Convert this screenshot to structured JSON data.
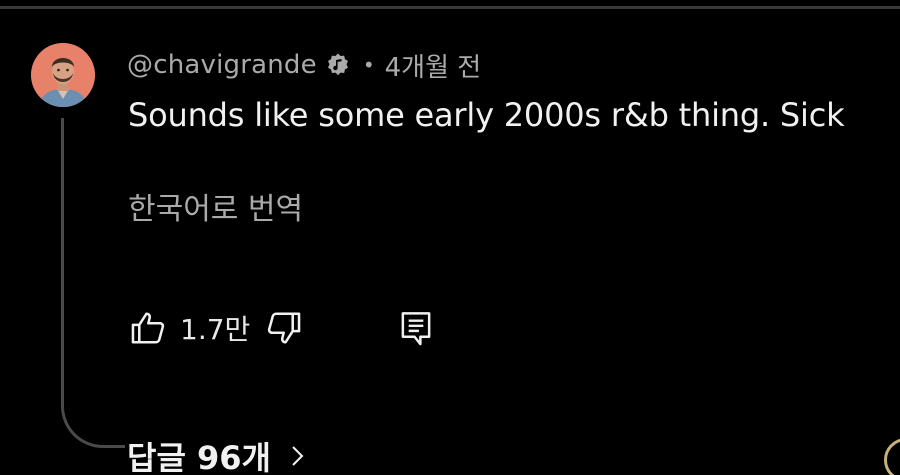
{
  "comment": {
    "handle": "@chavigrande",
    "badge_icon": "music-note-verified-badge-icon",
    "separator": "•",
    "time": "4개월 전",
    "text": "Sounds like some early 2000s r&b thing. Sick",
    "translate_label": "한국어로 번역",
    "like_count": "1.7만",
    "replies_label": "답글 96개"
  },
  "icons": {
    "like": "thumbs-up-icon",
    "dislike": "thumbs-down-icon",
    "reply": "comment-reply-icon",
    "replies_chevron": "chevron-right-icon"
  },
  "colors": {
    "background": "#000000",
    "primary_text": "#f1f1f1",
    "secondary_text": "#aaaaaa",
    "avatar_bg": "#e8816a"
  }
}
